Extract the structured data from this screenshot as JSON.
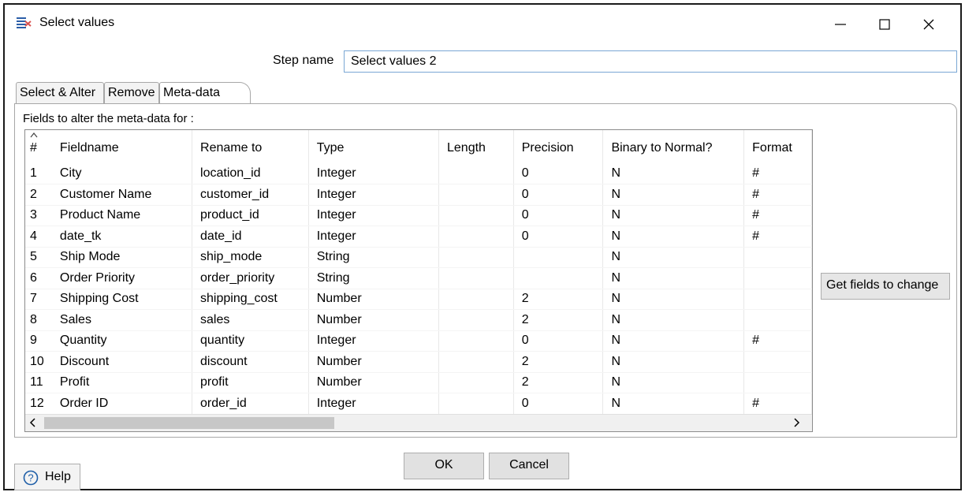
{
  "window": {
    "title": "Select values"
  },
  "step": {
    "label": "Step name",
    "value": "Select values 2"
  },
  "tabs": [
    {
      "label": "Select & Alter"
    },
    {
      "label": "Remove"
    },
    {
      "label": "Meta-data"
    }
  ],
  "panel": {
    "fields_label": "Fields to alter the meta-data for :"
  },
  "table": {
    "headers": [
      "#",
      "Fieldname",
      "Rename to",
      "Type",
      "Length",
      "Precision",
      "Binary to Normal?",
      "Format"
    ],
    "rows": [
      [
        "1",
        "City",
        "location_id",
        "Integer",
        "",
        "0",
        "N",
        "#"
      ],
      [
        "2",
        "Customer Name",
        "customer_id",
        "Integer",
        "",
        "0",
        "N",
        "#"
      ],
      [
        "3",
        "Product Name",
        "product_id",
        "Integer",
        "",
        "0",
        "N",
        "#"
      ],
      [
        "4",
        "date_tk",
        "date_id",
        "Integer",
        "",
        "0",
        "N",
        "#"
      ],
      [
        "5",
        "Ship Mode",
        "ship_mode",
        "String",
        "",
        "",
        "N",
        ""
      ],
      [
        "6",
        "Order Priority",
        "order_priority",
        "String",
        "",
        "",
        "N",
        ""
      ],
      [
        "7",
        "Shipping Cost",
        "shipping_cost",
        "Number",
        "",
        "2",
        "N",
        ""
      ],
      [
        "8",
        "Sales",
        "sales",
        "Number",
        "",
        "2",
        "N",
        ""
      ],
      [
        "9",
        "Quantity",
        "quantity",
        "Integer",
        "",
        "0",
        "N",
        "#"
      ],
      [
        "10",
        "Discount",
        "discount",
        "Number",
        "",
        "2",
        "N",
        ""
      ],
      [
        "11",
        "Profit",
        "profit",
        "Number",
        "",
        "2",
        "N",
        ""
      ],
      [
        "12",
        "Order ID",
        "order_id",
        "Integer",
        "",
        "0",
        "N",
        "#"
      ]
    ]
  },
  "buttons": {
    "get_fields": "Get fields to change",
    "ok": "OK",
    "cancel": "Cancel",
    "help": "Help"
  }
}
